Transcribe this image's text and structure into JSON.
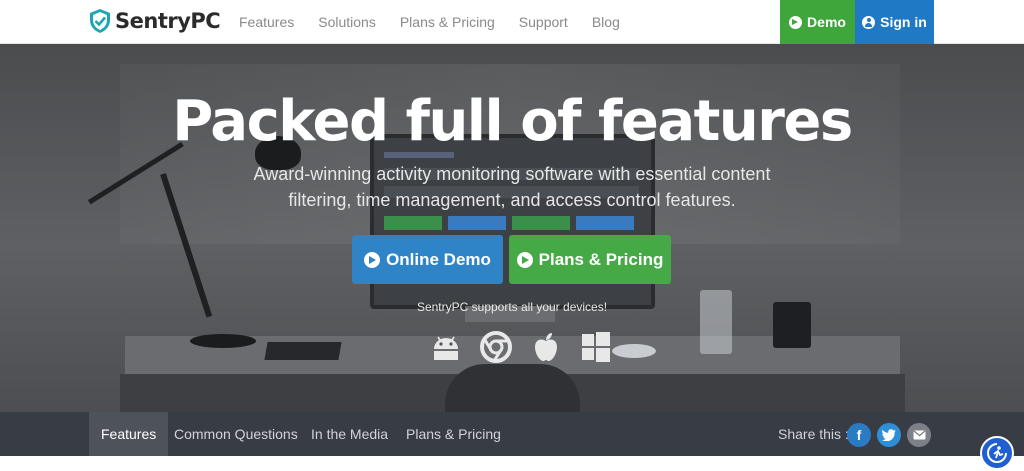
{
  "header": {
    "logo_text": "SentryPC",
    "nav": [
      "Features",
      "Solutions",
      "Plans & Pricing",
      "Support",
      "Blog"
    ],
    "demo_label": "Demo",
    "signin_label": "Sign in",
    "colors": {
      "demo": "#3fa63b",
      "signin": "#1f79c4",
      "logo_shield": "#19a7b4"
    }
  },
  "hero": {
    "title": "Packed full of features",
    "subtitle": "Award-winning activity monitoring software with essential content filtering, time management, and access control features.",
    "primary_button": "Online Demo",
    "secondary_button": "Plans & Pricing",
    "supports_text": "SentryPC supports all your devices!",
    "device_icons": [
      "android-icon",
      "chrome-icon",
      "apple-icon",
      "windows-icon"
    ]
  },
  "subnav": {
    "tabs": [
      "Features",
      "Common Questions",
      "In the Media",
      "Plans & Pricing"
    ],
    "active_tab": "Features",
    "share_label": "Share this :",
    "share_icons": [
      "facebook-icon",
      "twitter-icon",
      "email-icon"
    ]
  },
  "accessibility_icon": "accessibility-icon"
}
